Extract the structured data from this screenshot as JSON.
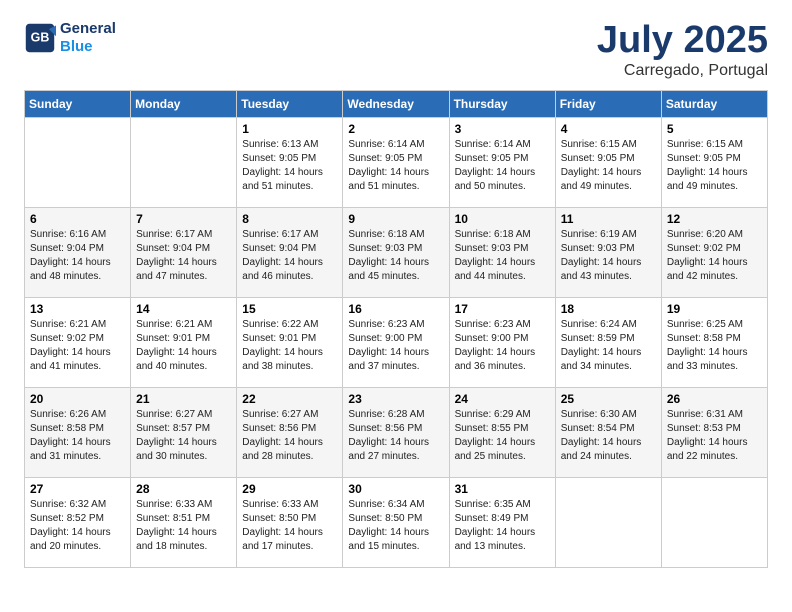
{
  "header": {
    "logo_line1": "General",
    "logo_line2": "Blue",
    "month": "July 2025",
    "location": "Carregado, Portugal"
  },
  "weekdays": [
    "Sunday",
    "Monday",
    "Tuesday",
    "Wednesday",
    "Thursday",
    "Friday",
    "Saturday"
  ],
  "weeks": [
    [
      {
        "day": "",
        "sunrise": "",
        "sunset": "",
        "daylight": ""
      },
      {
        "day": "",
        "sunrise": "",
        "sunset": "",
        "daylight": ""
      },
      {
        "day": "1",
        "sunrise": "Sunrise: 6:13 AM",
        "sunset": "Sunset: 9:05 PM",
        "daylight": "Daylight: 14 hours and 51 minutes."
      },
      {
        "day": "2",
        "sunrise": "Sunrise: 6:14 AM",
        "sunset": "Sunset: 9:05 PM",
        "daylight": "Daylight: 14 hours and 51 minutes."
      },
      {
        "day": "3",
        "sunrise": "Sunrise: 6:14 AM",
        "sunset": "Sunset: 9:05 PM",
        "daylight": "Daylight: 14 hours and 50 minutes."
      },
      {
        "day": "4",
        "sunrise": "Sunrise: 6:15 AM",
        "sunset": "Sunset: 9:05 PM",
        "daylight": "Daylight: 14 hours and 49 minutes."
      },
      {
        "day": "5",
        "sunrise": "Sunrise: 6:15 AM",
        "sunset": "Sunset: 9:05 PM",
        "daylight": "Daylight: 14 hours and 49 minutes."
      }
    ],
    [
      {
        "day": "6",
        "sunrise": "Sunrise: 6:16 AM",
        "sunset": "Sunset: 9:04 PM",
        "daylight": "Daylight: 14 hours and 48 minutes."
      },
      {
        "day": "7",
        "sunrise": "Sunrise: 6:17 AM",
        "sunset": "Sunset: 9:04 PM",
        "daylight": "Daylight: 14 hours and 47 minutes."
      },
      {
        "day": "8",
        "sunrise": "Sunrise: 6:17 AM",
        "sunset": "Sunset: 9:04 PM",
        "daylight": "Daylight: 14 hours and 46 minutes."
      },
      {
        "day": "9",
        "sunrise": "Sunrise: 6:18 AM",
        "sunset": "Sunset: 9:03 PM",
        "daylight": "Daylight: 14 hours and 45 minutes."
      },
      {
        "day": "10",
        "sunrise": "Sunrise: 6:18 AM",
        "sunset": "Sunset: 9:03 PM",
        "daylight": "Daylight: 14 hours and 44 minutes."
      },
      {
        "day": "11",
        "sunrise": "Sunrise: 6:19 AM",
        "sunset": "Sunset: 9:03 PM",
        "daylight": "Daylight: 14 hours and 43 minutes."
      },
      {
        "day": "12",
        "sunrise": "Sunrise: 6:20 AM",
        "sunset": "Sunset: 9:02 PM",
        "daylight": "Daylight: 14 hours and 42 minutes."
      }
    ],
    [
      {
        "day": "13",
        "sunrise": "Sunrise: 6:21 AM",
        "sunset": "Sunset: 9:02 PM",
        "daylight": "Daylight: 14 hours and 41 minutes."
      },
      {
        "day": "14",
        "sunrise": "Sunrise: 6:21 AM",
        "sunset": "Sunset: 9:01 PM",
        "daylight": "Daylight: 14 hours and 40 minutes."
      },
      {
        "day": "15",
        "sunrise": "Sunrise: 6:22 AM",
        "sunset": "Sunset: 9:01 PM",
        "daylight": "Daylight: 14 hours and 38 minutes."
      },
      {
        "day": "16",
        "sunrise": "Sunrise: 6:23 AM",
        "sunset": "Sunset: 9:00 PM",
        "daylight": "Daylight: 14 hours and 37 minutes."
      },
      {
        "day": "17",
        "sunrise": "Sunrise: 6:23 AM",
        "sunset": "Sunset: 9:00 PM",
        "daylight": "Daylight: 14 hours and 36 minutes."
      },
      {
        "day": "18",
        "sunrise": "Sunrise: 6:24 AM",
        "sunset": "Sunset: 8:59 PM",
        "daylight": "Daylight: 14 hours and 34 minutes."
      },
      {
        "day": "19",
        "sunrise": "Sunrise: 6:25 AM",
        "sunset": "Sunset: 8:58 PM",
        "daylight": "Daylight: 14 hours and 33 minutes."
      }
    ],
    [
      {
        "day": "20",
        "sunrise": "Sunrise: 6:26 AM",
        "sunset": "Sunset: 8:58 PM",
        "daylight": "Daylight: 14 hours and 31 minutes."
      },
      {
        "day": "21",
        "sunrise": "Sunrise: 6:27 AM",
        "sunset": "Sunset: 8:57 PM",
        "daylight": "Daylight: 14 hours and 30 minutes."
      },
      {
        "day": "22",
        "sunrise": "Sunrise: 6:27 AM",
        "sunset": "Sunset: 8:56 PM",
        "daylight": "Daylight: 14 hours and 28 minutes."
      },
      {
        "day": "23",
        "sunrise": "Sunrise: 6:28 AM",
        "sunset": "Sunset: 8:56 PM",
        "daylight": "Daylight: 14 hours and 27 minutes."
      },
      {
        "day": "24",
        "sunrise": "Sunrise: 6:29 AM",
        "sunset": "Sunset: 8:55 PM",
        "daylight": "Daylight: 14 hours and 25 minutes."
      },
      {
        "day": "25",
        "sunrise": "Sunrise: 6:30 AM",
        "sunset": "Sunset: 8:54 PM",
        "daylight": "Daylight: 14 hours and 24 minutes."
      },
      {
        "day": "26",
        "sunrise": "Sunrise: 6:31 AM",
        "sunset": "Sunset: 8:53 PM",
        "daylight": "Daylight: 14 hours and 22 minutes."
      }
    ],
    [
      {
        "day": "27",
        "sunrise": "Sunrise: 6:32 AM",
        "sunset": "Sunset: 8:52 PM",
        "daylight": "Daylight: 14 hours and 20 minutes."
      },
      {
        "day": "28",
        "sunrise": "Sunrise: 6:33 AM",
        "sunset": "Sunset: 8:51 PM",
        "daylight": "Daylight: 14 hours and 18 minutes."
      },
      {
        "day": "29",
        "sunrise": "Sunrise: 6:33 AM",
        "sunset": "Sunset: 8:50 PM",
        "daylight": "Daylight: 14 hours and 17 minutes."
      },
      {
        "day": "30",
        "sunrise": "Sunrise: 6:34 AM",
        "sunset": "Sunset: 8:50 PM",
        "daylight": "Daylight: 14 hours and 15 minutes."
      },
      {
        "day": "31",
        "sunrise": "Sunrise: 6:35 AM",
        "sunset": "Sunset: 8:49 PM",
        "daylight": "Daylight: 14 hours and 13 minutes."
      },
      {
        "day": "",
        "sunrise": "",
        "sunset": "",
        "daylight": ""
      },
      {
        "day": "",
        "sunrise": "",
        "sunset": "",
        "daylight": ""
      }
    ]
  ]
}
